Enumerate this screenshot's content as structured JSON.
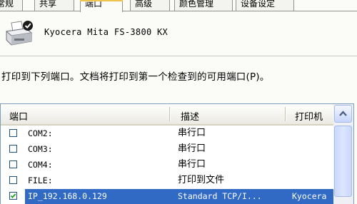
{
  "tabs": [
    {
      "label": "常规"
    },
    {
      "label": "共享"
    },
    {
      "label": "端口"
    },
    {
      "label": "高级"
    },
    {
      "label": "颜色管理"
    },
    {
      "label": "设备设定"
    }
  ],
  "printer": {
    "name": "Kyocera Mita FS-3800 KX"
  },
  "instruction": "打印到下列端口。文档将打印到第一个检查到的可用端口(P)。",
  "ports_table": {
    "columns": [
      {
        "label": "端口"
      },
      {
        "label": "描述"
      },
      {
        "label": "打印机"
      }
    ],
    "rows": [
      {
        "port": "COM2:",
        "description": "串行口",
        "printer": "",
        "checked": false,
        "selected": false
      },
      {
        "port": "COM3:",
        "description": "串行口",
        "printer": "",
        "checked": false,
        "selected": false
      },
      {
        "port": "COM4:",
        "description": "串行口",
        "printer": "",
        "checked": false,
        "selected": false
      },
      {
        "port": "FILE:",
        "description": "打印到文件",
        "printer": "",
        "checked": false,
        "selected": false
      },
      {
        "port": "IP_192.168.0.129",
        "description": "Standard TCP/I...",
        "printer": "Kyocera",
        "checked": true,
        "selected": true
      }
    ]
  },
  "colors": {
    "selection": "#316ac5",
    "tab_highlight": "#f0c24e",
    "list_border": "#7f9db9"
  },
  "icons": {
    "printer": "printer-icon",
    "scroll_up": "scroll-up-arrow-icon",
    "check": "checkmark-icon"
  }
}
